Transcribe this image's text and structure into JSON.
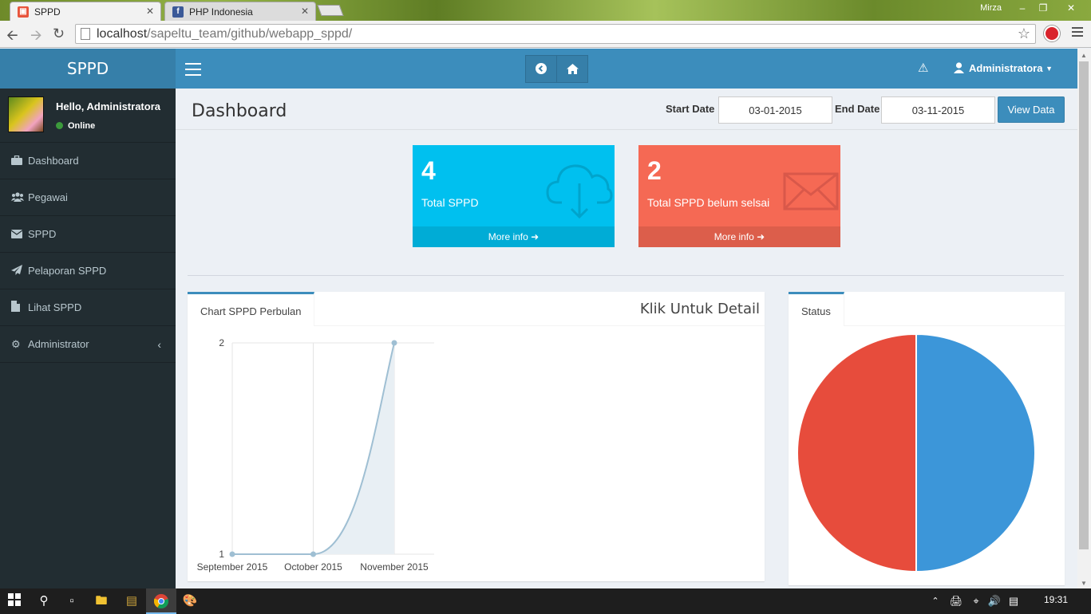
{
  "browser": {
    "tabs": [
      {
        "title": "SPPD",
        "favicon_color": "#e8553d"
      },
      {
        "title": "PHP Indonesia",
        "favicon_color": "#3b5998"
      }
    ],
    "user": "Mirza",
    "url_host": "localhost",
    "url_path": "/sapeltu_team/github/webapp_sppd/"
  },
  "app": {
    "logo": "SPPD",
    "user_greeting": "Hello, Administratora",
    "status": "Online",
    "account_name": "Administratora",
    "menu": [
      {
        "label": "Dashboard",
        "icon": "briefcase-icon"
      },
      {
        "label": "Pegawai",
        "icon": "users-icon"
      },
      {
        "label": "SPPD",
        "icon": "envelope-icon"
      },
      {
        "label": "Pelaporan SPPD",
        "icon": "paper-plane-icon"
      },
      {
        "label": "Lihat SPPD",
        "icon": "file-icon"
      },
      {
        "label": "Administrator",
        "icon": "cogs-icon"
      }
    ]
  },
  "header": {
    "title": "Dashboard",
    "start_label": "Start Date",
    "start_value": "03-01-2015",
    "end_label": "End Date",
    "end_value": "03-11-2015",
    "view_button": "View Data"
  },
  "stats": [
    {
      "value": "4",
      "label": "Total SPPD",
      "more": "More info",
      "color": "#00c0ef",
      "icon": "cloud-download-icon"
    },
    {
      "value": "2",
      "label": "Total SPPD belum selsai",
      "more": "More info",
      "color": "#f56954",
      "icon": "envelope-icon"
    }
  ],
  "chart_panel": {
    "tab": "Chart SPPD Perbulan",
    "action": "Klik Untuk Detail"
  },
  "status_panel": {
    "tab": "Status"
  },
  "chart_data": [
    {
      "type": "area",
      "categories": [
        "September 2015",
        "October 2015",
        "November 2015"
      ],
      "series": [
        {
          "values": [
            1,
            1,
            2
          ]
        }
      ],
      "yticks": [
        "1",
        "2"
      ],
      "ylim": [
        1,
        2
      ],
      "grid": true,
      "colors": {
        "line": "#9fbfd3",
        "fill": "#e8eff4",
        "point": "#9fbfd3"
      }
    },
    {
      "type": "pie",
      "slices": [
        {
          "value": 50,
          "color": "#3c96d9"
        },
        {
          "value": 50,
          "color": "#e74c3c"
        }
      ]
    }
  ],
  "taskbar": {
    "time": "19:31"
  }
}
